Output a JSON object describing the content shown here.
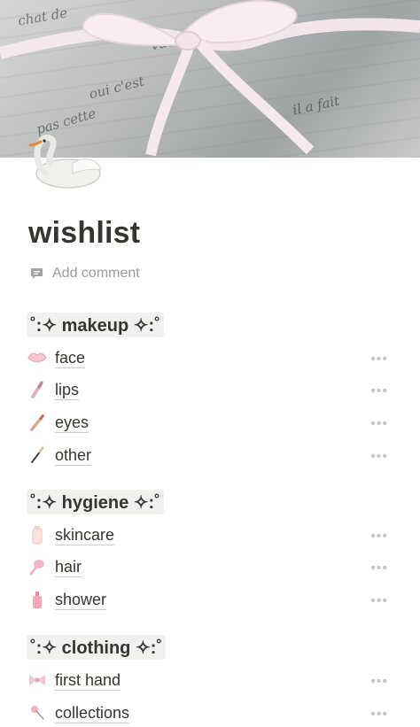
{
  "page": {
    "title": "wishlist",
    "add_comment": "Add comment"
  },
  "cover": {
    "script_lines": [
      "chat de",
      "vue",
      "oui c'est",
      "pas cette",
      "il a fait"
    ]
  },
  "sections": [
    {
      "heading": "˚:✧ makeup ✧:˚",
      "items": [
        {
          "label": "face",
          "icon": "lips-face-icon"
        },
        {
          "label": "lips",
          "icon": "lipstick-icon"
        },
        {
          "label": "eyes",
          "icon": "eye-pencil-icon"
        },
        {
          "label": "other",
          "icon": "brush-icon"
        }
      ]
    },
    {
      "heading": "˚:✧ hygiene ✧:˚",
      "items": [
        {
          "label": "skincare",
          "icon": "lotion-tube-icon"
        },
        {
          "label": "hair",
          "icon": "hairbrush-icon"
        },
        {
          "label": "shower",
          "icon": "shower-bottle-icon"
        }
      ]
    },
    {
      "heading": "˚:✧ clothing ✧:˚",
      "items": [
        {
          "label": "first hand",
          "icon": "bow-icon"
        },
        {
          "label": "collections",
          "icon": "pin-icon"
        }
      ]
    }
  ],
  "more_glyph": "•••"
}
